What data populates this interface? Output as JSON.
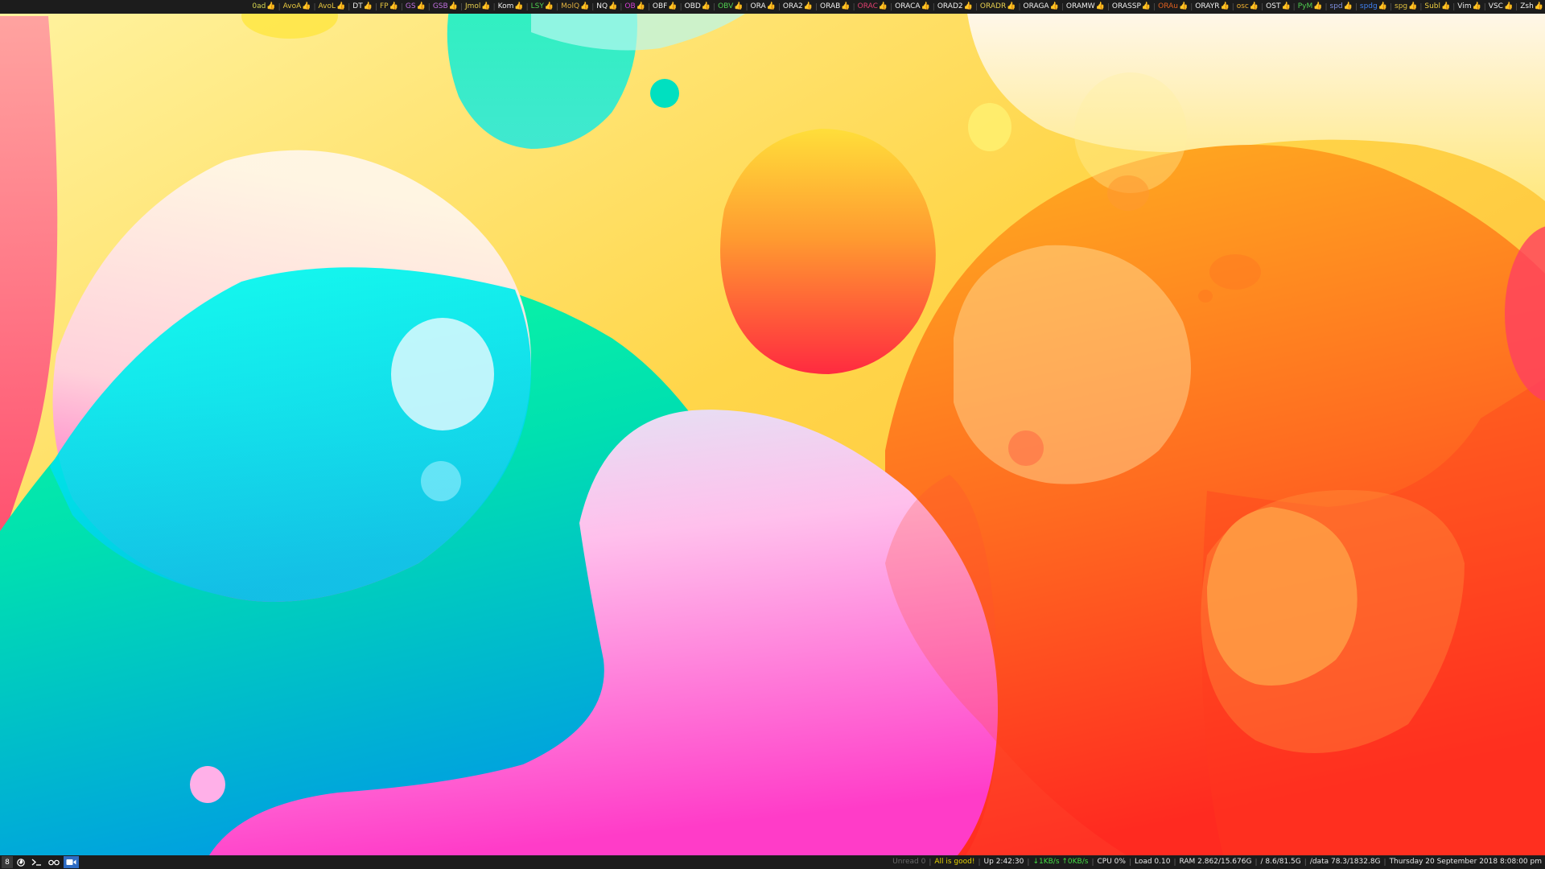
{
  "colors": {
    "bar_bg": "#1c1c1c",
    "separator": "#555555",
    "status_text": "#e8e8e8",
    "status_green": "#44dd44",
    "status_yellow": "#e6d200",
    "status_gray": "#6a6a6a"
  },
  "top_bar": {
    "items": [
      {
        "label": "0ad",
        "icon": "thumbs-up-icon",
        "glyph": "👍",
        "color": "#d6d650"
      },
      {
        "label": "AvoA",
        "icon": "thumbs-up-icon",
        "glyph": "👍",
        "color": "#e8c840"
      },
      {
        "label": "AvoL",
        "icon": "thumbs-up-icon",
        "glyph": "👍",
        "color": "#e8c840"
      },
      {
        "label": "DT",
        "icon": "thumbs-up-icon",
        "glyph": "👍",
        "color": "#f0f0f0"
      },
      {
        "label": "FP",
        "icon": "thumbs-up-icon",
        "glyph": "👍",
        "color": "#e0c040"
      },
      {
        "label": "GS",
        "icon": "thumbs-up-icon",
        "glyph": "👍",
        "color": "#c070e0"
      },
      {
        "label": "GSB",
        "icon": "thumbs-up-icon",
        "glyph": "👍",
        "color": "#c070e0"
      },
      {
        "label": "Jmol",
        "icon": "thumbs-up-icon",
        "glyph": "👍",
        "color": "#e8d050"
      },
      {
        "label": "Kom",
        "icon": "thumbs-up-icon",
        "glyph": "👍",
        "color": "#f0f0f0"
      },
      {
        "label": "LSY",
        "icon": "thumbs-up-icon",
        "glyph": "👍",
        "color": "#50d050"
      },
      {
        "label": "MolQ",
        "icon": "thumbs-up-icon",
        "glyph": "👍",
        "color": "#e0b040"
      },
      {
        "label": "NQ",
        "icon": "thumbs-up-icon",
        "glyph": "👍",
        "color": "#f0f0f0"
      },
      {
        "label": "OB",
        "icon": "thumbs-up-icon",
        "glyph": "👍",
        "color": "#d040d0"
      },
      {
        "label": "OBF",
        "icon": "thumbs-up-icon",
        "glyph": "👍",
        "color": "#f0f0f0"
      },
      {
        "label": "OBD",
        "icon": "thumbs-up-icon",
        "glyph": "👍",
        "color": "#f0f0f0"
      },
      {
        "label": "OBV",
        "icon": "thumbs-up-icon",
        "glyph": "👍",
        "color": "#50d050"
      },
      {
        "label": "ORA",
        "icon": "thumbs-up-icon",
        "glyph": "👍",
        "color": "#f0f0f0"
      },
      {
        "label": "ORA2",
        "icon": "thumbs-up-icon",
        "glyph": "👍",
        "color": "#f0f0f0"
      },
      {
        "label": "ORAB",
        "icon": "thumbs-up-icon",
        "glyph": "👍",
        "color": "#f0f0f0"
      },
      {
        "label": "ORAC",
        "icon": "thumbs-up-icon",
        "glyph": "👍",
        "color": "#e04070"
      },
      {
        "label": "ORACA",
        "icon": "thumbs-up-icon",
        "glyph": "👍",
        "color": "#f0f0f0"
      },
      {
        "label": "ORAD2",
        "icon": "thumbs-up-icon",
        "glyph": "👍",
        "color": "#f0f0f0"
      },
      {
        "label": "ORADR",
        "icon": "thumbs-up-icon",
        "glyph": "👍",
        "color": "#e8d050"
      },
      {
        "label": "ORAGA",
        "icon": "thumbs-up-icon",
        "glyph": "👍",
        "color": "#f0f0f0"
      },
      {
        "label": "ORAMW",
        "icon": "thumbs-up-icon",
        "glyph": "👍",
        "color": "#f0f0f0"
      },
      {
        "label": "ORASSP",
        "icon": "thumbs-up-icon",
        "glyph": "👍",
        "color": "#f0f0f0"
      },
      {
        "label": "ORAu",
        "icon": "thumbs-up-icon",
        "glyph": "👍",
        "color": "#e06020"
      },
      {
        "label": "ORAYR",
        "icon": "thumbs-up-icon",
        "glyph": "👍",
        "color": "#f0f0f0"
      },
      {
        "label": "osc",
        "icon": "thumbs-up-icon",
        "glyph": "👍",
        "color": "#f0b030"
      },
      {
        "label": "OST",
        "icon": "thumbs-up-icon",
        "glyph": "👍",
        "color": "#f0f0f0"
      },
      {
        "label": "PyM",
        "icon": "thumbs-up-icon",
        "glyph": "👍",
        "color": "#50d050"
      },
      {
        "label": "spd",
        "icon": "thumbs-up-icon",
        "glyph": "👍",
        "color": "#8090e0"
      },
      {
        "label": "spdg",
        "icon": "thumbs-up-icon",
        "glyph": "👍",
        "color": "#4080f0"
      },
      {
        "label": "spg",
        "icon": "thumbs-up-icon",
        "glyph": "👍",
        "color": "#e0c040"
      },
      {
        "label": "Subl",
        "icon": "thumbs-up-icon",
        "glyph": "👍",
        "color": "#f0d040"
      },
      {
        "label": "Vim",
        "icon": "thumbs-up-icon",
        "glyph": "👍",
        "color": "#f0f0f0"
      },
      {
        "label": "VSC",
        "icon": "thumbs-up-icon",
        "glyph": "👍",
        "color": "#f0f0f0"
      },
      {
        "label": "Zsh",
        "icon": "thumbs-up-icon",
        "glyph": "👍",
        "color": "#f0f0f0"
      }
    ]
  },
  "bottom_bar": {
    "workspaces": [
      {
        "label": "8",
        "state": "active"
      },
      {
        "icon": "firefox-icon",
        "state": "normal"
      },
      {
        "icon": "terminal-icon",
        "state": "normal"
      },
      {
        "icon": "glasses-icon",
        "state": "normal"
      },
      {
        "icon": "video-camera-icon",
        "state": "focused"
      }
    ],
    "status": [
      {
        "name": "status-unread",
        "text": "Unread 0",
        "color": "#6a6a6a"
      },
      {
        "name": "status-health",
        "text": "All is good!",
        "color": "#e6d200"
      },
      {
        "name": "status-uptime",
        "text": "Up 2:42:30",
        "color": "#e8e8e8"
      },
      {
        "name": "status-network",
        "text": "↓1KB/s ↑0KB/s",
        "color": "#44dd44"
      },
      {
        "name": "status-cpu",
        "text": "CPU 0%",
        "color": "#e8e8e8"
      },
      {
        "name": "status-load",
        "text": "Load 0.10",
        "color": "#e8e8e8"
      },
      {
        "name": "status-ram",
        "text": "RAM 2.862/15.676G",
        "color": "#e8e8e8"
      },
      {
        "name": "status-disk-root",
        "text": "/ 8.6/81.5G",
        "color": "#e8e8e8"
      },
      {
        "name": "status-disk-data",
        "text": "/data 78.3/1832.8G",
        "color": "#e8e8e8"
      },
      {
        "name": "status-datetime",
        "text": "Thursday 20 September 2018 8:08:00 pm",
        "color": "#e8e8e8"
      }
    ]
  }
}
